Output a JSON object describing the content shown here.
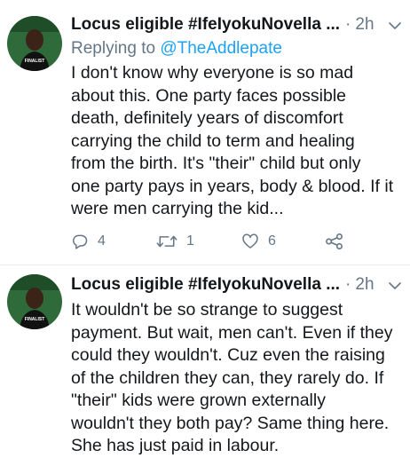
{
  "tweets": [
    {
      "name": "Locus eligible #IfeIyokuNovella ...",
      "time": "2h",
      "replying_prefix": "Replying to ",
      "replying_handle": "@TheAddlepate",
      "body": "I don't know why everyone is so mad\nabout this. One party faces possible\ndeath, definitely years of discomfort\ncarrying the child to term and healing\nfrom the birth. It's \"their\" child but only\none party pays in years, body & blood. If it\nwere men carrying the kid...",
      "reply_count": "4",
      "retweet_count": "1",
      "like_count": "6"
    },
    {
      "name": "Locus eligible #IfeIyokuNovella ...",
      "time": "2h",
      "body": "It wouldn't be so strange to suggest\npayment. But wait, men can't. Even if they\ncould they wouldn't. Cuz even the raising\nof the children they can, they rarely do. If\n\"their\"  kids were grown externally\nwouldn't they both pay? Same thing here.\nShe has just paid in labour."
    }
  ],
  "avatar_text": "FINALIST",
  "colors": {
    "accent": "#1da1f2",
    "secondary_text": "#657786",
    "avatar_green": "#2f6b3a"
  },
  "icons": [
    "reply-icon",
    "retweet-icon",
    "like-icon",
    "share-icon",
    "chevron-down-icon"
  ]
}
